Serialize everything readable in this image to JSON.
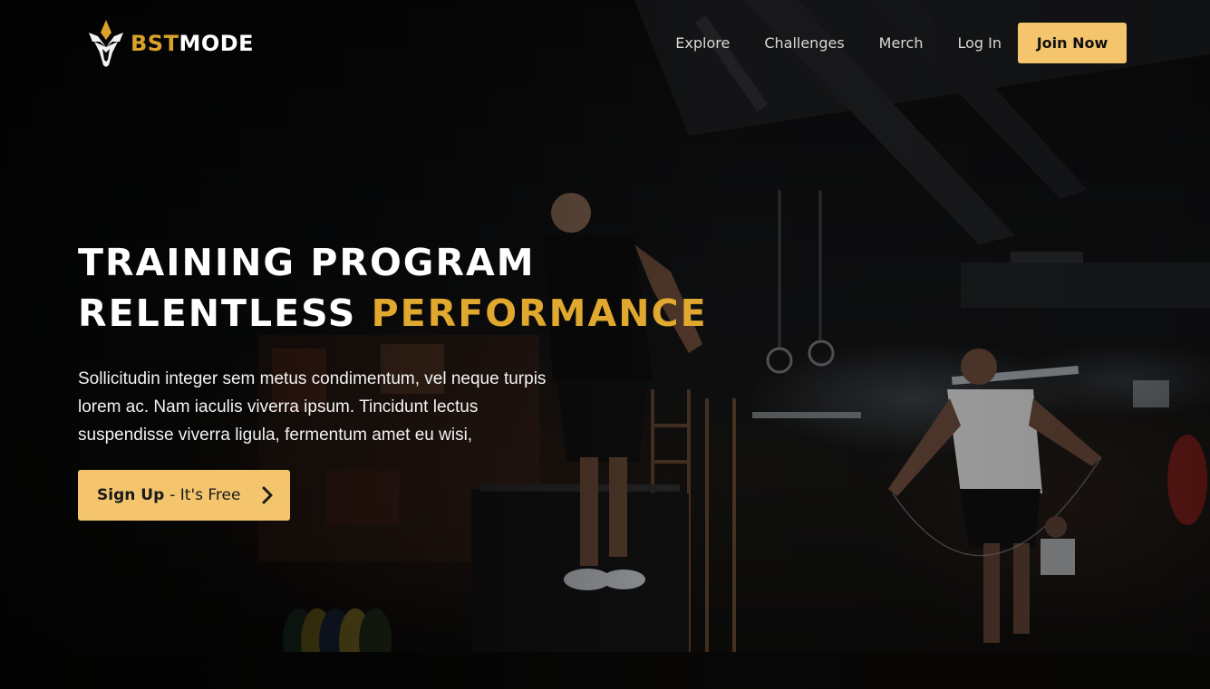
{
  "brand": {
    "name_part1": "BST",
    "name_part2": "MODE",
    "logo_icon": "spartan-helmet-icon",
    "gold": "#d9a22b"
  },
  "nav": {
    "links": [
      "Explore",
      "Challenges",
      "Merch"
    ],
    "login_label": "Log In",
    "join_label": "Join Now"
  },
  "hero": {
    "headline_line1": "TRAINING PROGRAM",
    "headline_line2_plain": "RELENTLESS",
    "headline_line2_accent": "PERFORMANCE",
    "accent_color": "#e0a82e",
    "lead": "Sollicitudin integer sem metus condimentum, vel neque turpis lorem ac. Nam iaculis viverra ipsum. Tincidunt lectus suspendisse viverra ligula, fermentum amet eu wisi,",
    "cta_strong": "Sign Up",
    "cta_rest": "- It's Free",
    "cta_icon": "chevron-right-icon",
    "button_color": "#f4c56d"
  }
}
